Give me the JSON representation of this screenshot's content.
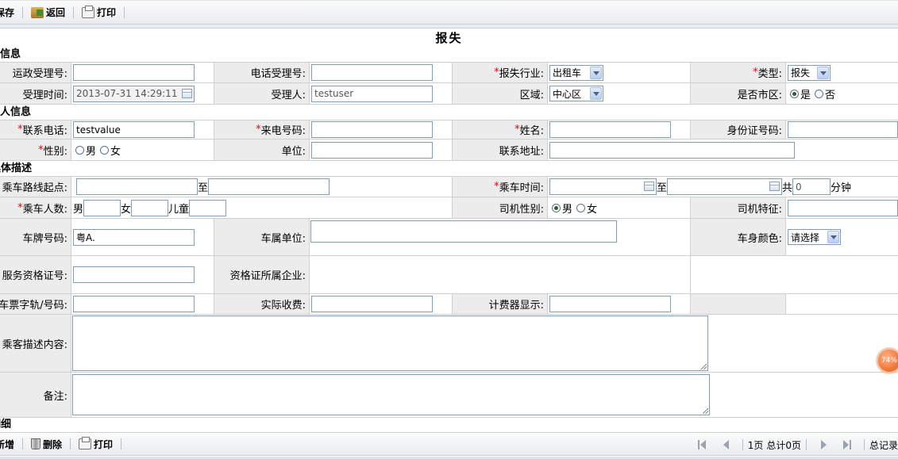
{
  "toolbar": {
    "save": "保存",
    "back": "返回",
    "print": "打印"
  },
  "title": "报失",
  "sections": {
    "receipt_info": "受理信息",
    "caller_info": "来电人信息",
    "detail": "具体描述",
    "list": "明细"
  },
  "row1": {
    "yunzheng_label": "运政受理号:",
    "yunzheng_value": "",
    "phone_receipt_label": "电话受理号:",
    "phone_receipt_value": "",
    "industry_label": "报失行业:",
    "industry_value": "出租车",
    "type_label": "类型:",
    "type_value": "报失"
  },
  "row2": {
    "time_label": "受理时间:",
    "time_value": "2013-07-31 14:29:11",
    "receiver_label": "受理人:",
    "receiver_value": "testuser",
    "area_label": "区域:",
    "area_value": "中心区",
    "city_label": "是否市区:",
    "yes": "是",
    "no": "否"
  },
  "row3": {
    "contact_phone_label": "联系电话:",
    "contact_phone_value": "testvalue",
    "incoming_label": "来电号码:",
    "incoming_value": "",
    "name_label": "姓名:",
    "name_value": "",
    "id_label": "身份证号码:",
    "id_value": ""
  },
  "row4": {
    "gender_label": "性别:",
    "male": "男",
    "female": "女",
    "unit_label": "单位:",
    "unit_value": "",
    "address_label": "联系地址:",
    "address_value": ""
  },
  "row5": {
    "route_label": "乘车路线起点:",
    "route_from": "",
    "to": "至",
    "route_to": "",
    "ride_time_label": "乘车时间:",
    "ride_from": "",
    "ride_to": "",
    "total": "共",
    "minutes_value": "0",
    "minutes_unit": "分钟"
  },
  "row6": {
    "passengers_label": "乘车人数:",
    "male": "男",
    "female": "女",
    "child": "儿童",
    "driver_gender_label": "司机性别:",
    "driver_male": "男",
    "driver_female": "女",
    "driver_feature_label": "司机特征:"
  },
  "row7": {
    "plate_label": "车牌号码:",
    "plate_value": "粤A.",
    "owner_unit_label": "车属单位:",
    "color_label": "车身颜色:",
    "color_value": "请选择"
  },
  "row8": {
    "cert_label": "服务资格证号:",
    "cert_company_label": "资格证所属企业:"
  },
  "row9": {
    "ticket_label": "车票字轨/号码:",
    "fee_label": "实际收费:",
    "meter_label": "计费器显示:"
  },
  "row10": {
    "desc_label": "乘客描述内容:"
  },
  "row11": {
    "remark_label": "备注:"
  },
  "bottom_toolbar": {
    "add": "新增",
    "delete": "删除",
    "print": "打印"
  },
  "pager": {
    "page": "1页",
    "total": "总计0页",
    "records": "总记录"
  },
  "zoom": "74%"
}
